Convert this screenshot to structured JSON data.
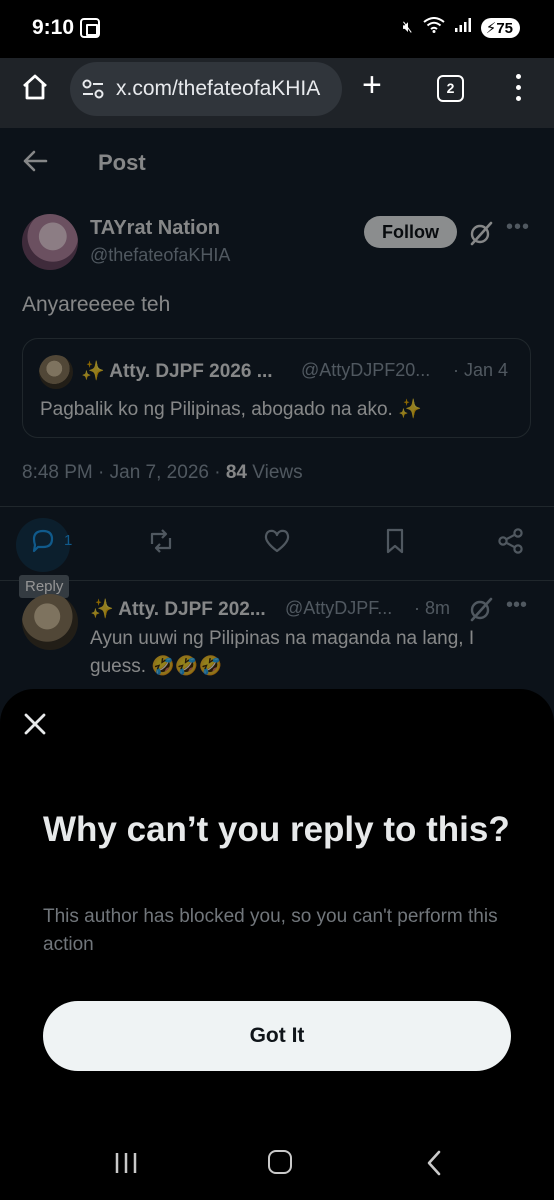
{
  "status_bar": {
    "time": "9:10",
    "battery": "75"
  },
  "browser": {
    "url": "x.com/thefateofaKHIA",
    "tab_count": "2"
  },
  "header": {
    "title": "Post"
  },
  "post": {
    "author_name": "TAYrat Nation",
    "author_handle": "@thefateofaKHIA",
    "follow_label": "Follow",
    "text": "Anyareeeee teh",
    "timestamp": "8:48 PM · Jan 7, 2026 · ",
    "views_count": "84",
    "views_label": " Views",
    "reply_count": "1",
    "reply_tooltip": "Reply"
  },
  "quoted_post": {
    "author_name": "✨ Atty. DJPF 2026 ...",
    "author_handle": "@AttyDJPF20...",
    "date": "· Jan 4",
    "text": "Pagbalik ko ng Pilipinas, abogado na ako. ✨"
  },
  "reply": {
    "author_name": "✨ Atty. DJPF 202...",
    "author_handle": "@AttyDJPF...",
    "time": "· 8m",
    "text": "Ayun uuwi ng Pilipinas na maganda na lang, I guess. 🤣🤣🤣"
  },
  "sheet": {
    "title": "Why can’t you reply to this?",
    "body": "This author has blocked you, so you can't perform this action",
    "button_label": "Got It"
  },
  "colors": {
    "background": "#15202b",
    "accent": "#1d9bf0",
    "sheet": "#000000",
    "button": "#eff3f4"
  }
}
